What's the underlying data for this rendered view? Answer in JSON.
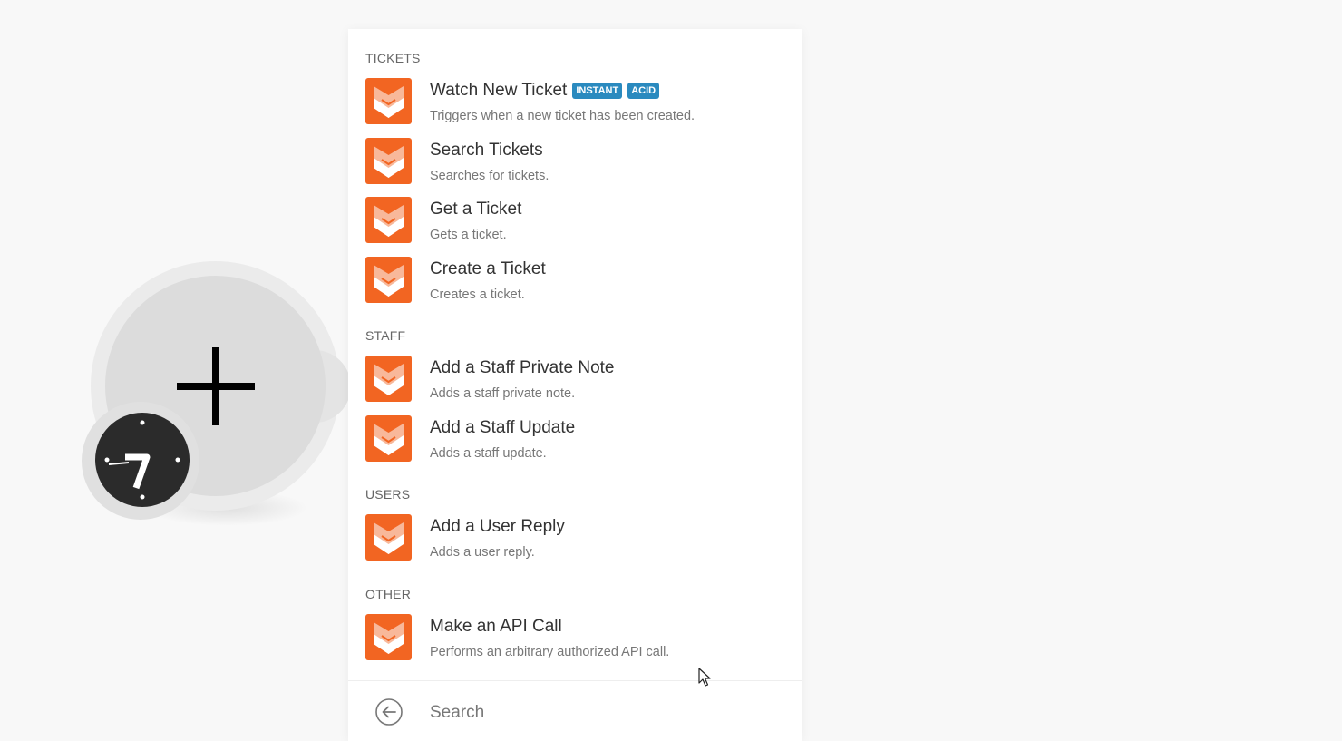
{
  "colors": {
    "brand_icon": "#f26522",
    "badge": "#2a8abf",
    "background": "#f8f8f8"
  },
  "module": {
    "plus_icon": "plus-icon",
    "clock_icon": "clock-icon"
  },
  "menu": {
    "sections": [
      {
        "title": "TICKETS",
        "items": [
          {
            "title": "Watch New Ticket",
            "badges": [
              "INSTANT",
              "ACID"
            ],
            "description": "Triggers when a new ticket has been created."
          },
          {
            "title": "Search Tickets",
            "description": "Searches for tickets."
          },
          {
            "title": "Get a Ticket",
            "description": "Gets a ticket."
          },
          {
            "title": "Create a Ticket",
            "description": "Creates a ticket."
          }
        ]
      },
      {
        "title": "STAFF",
        "items": [
          {
            "title": "Add a Staff Private Note",
            "description": "Adds a staff private note."
          },
          {
            "title": "Add a Staff Update",
            "description": "Adds a staff update."
          }
        ]
      },
      {
        "title": "USERS",
        "items": [
          {
            "title": "Add a User Reply",
            "description": "Adds a user reply."
          }
        ]
      },
      {
        "title": "OTHER",
        "items": [
          {
            "title": "Make an API Call",
            "description": "Performs an arbitrary authorized API call."
          }
        ]
      }
    ]
  },
  "search": {
    "placeholder": "Search",
    "value": "",
    "back_icon": "arrow-left-circle-icon"
  }
}
